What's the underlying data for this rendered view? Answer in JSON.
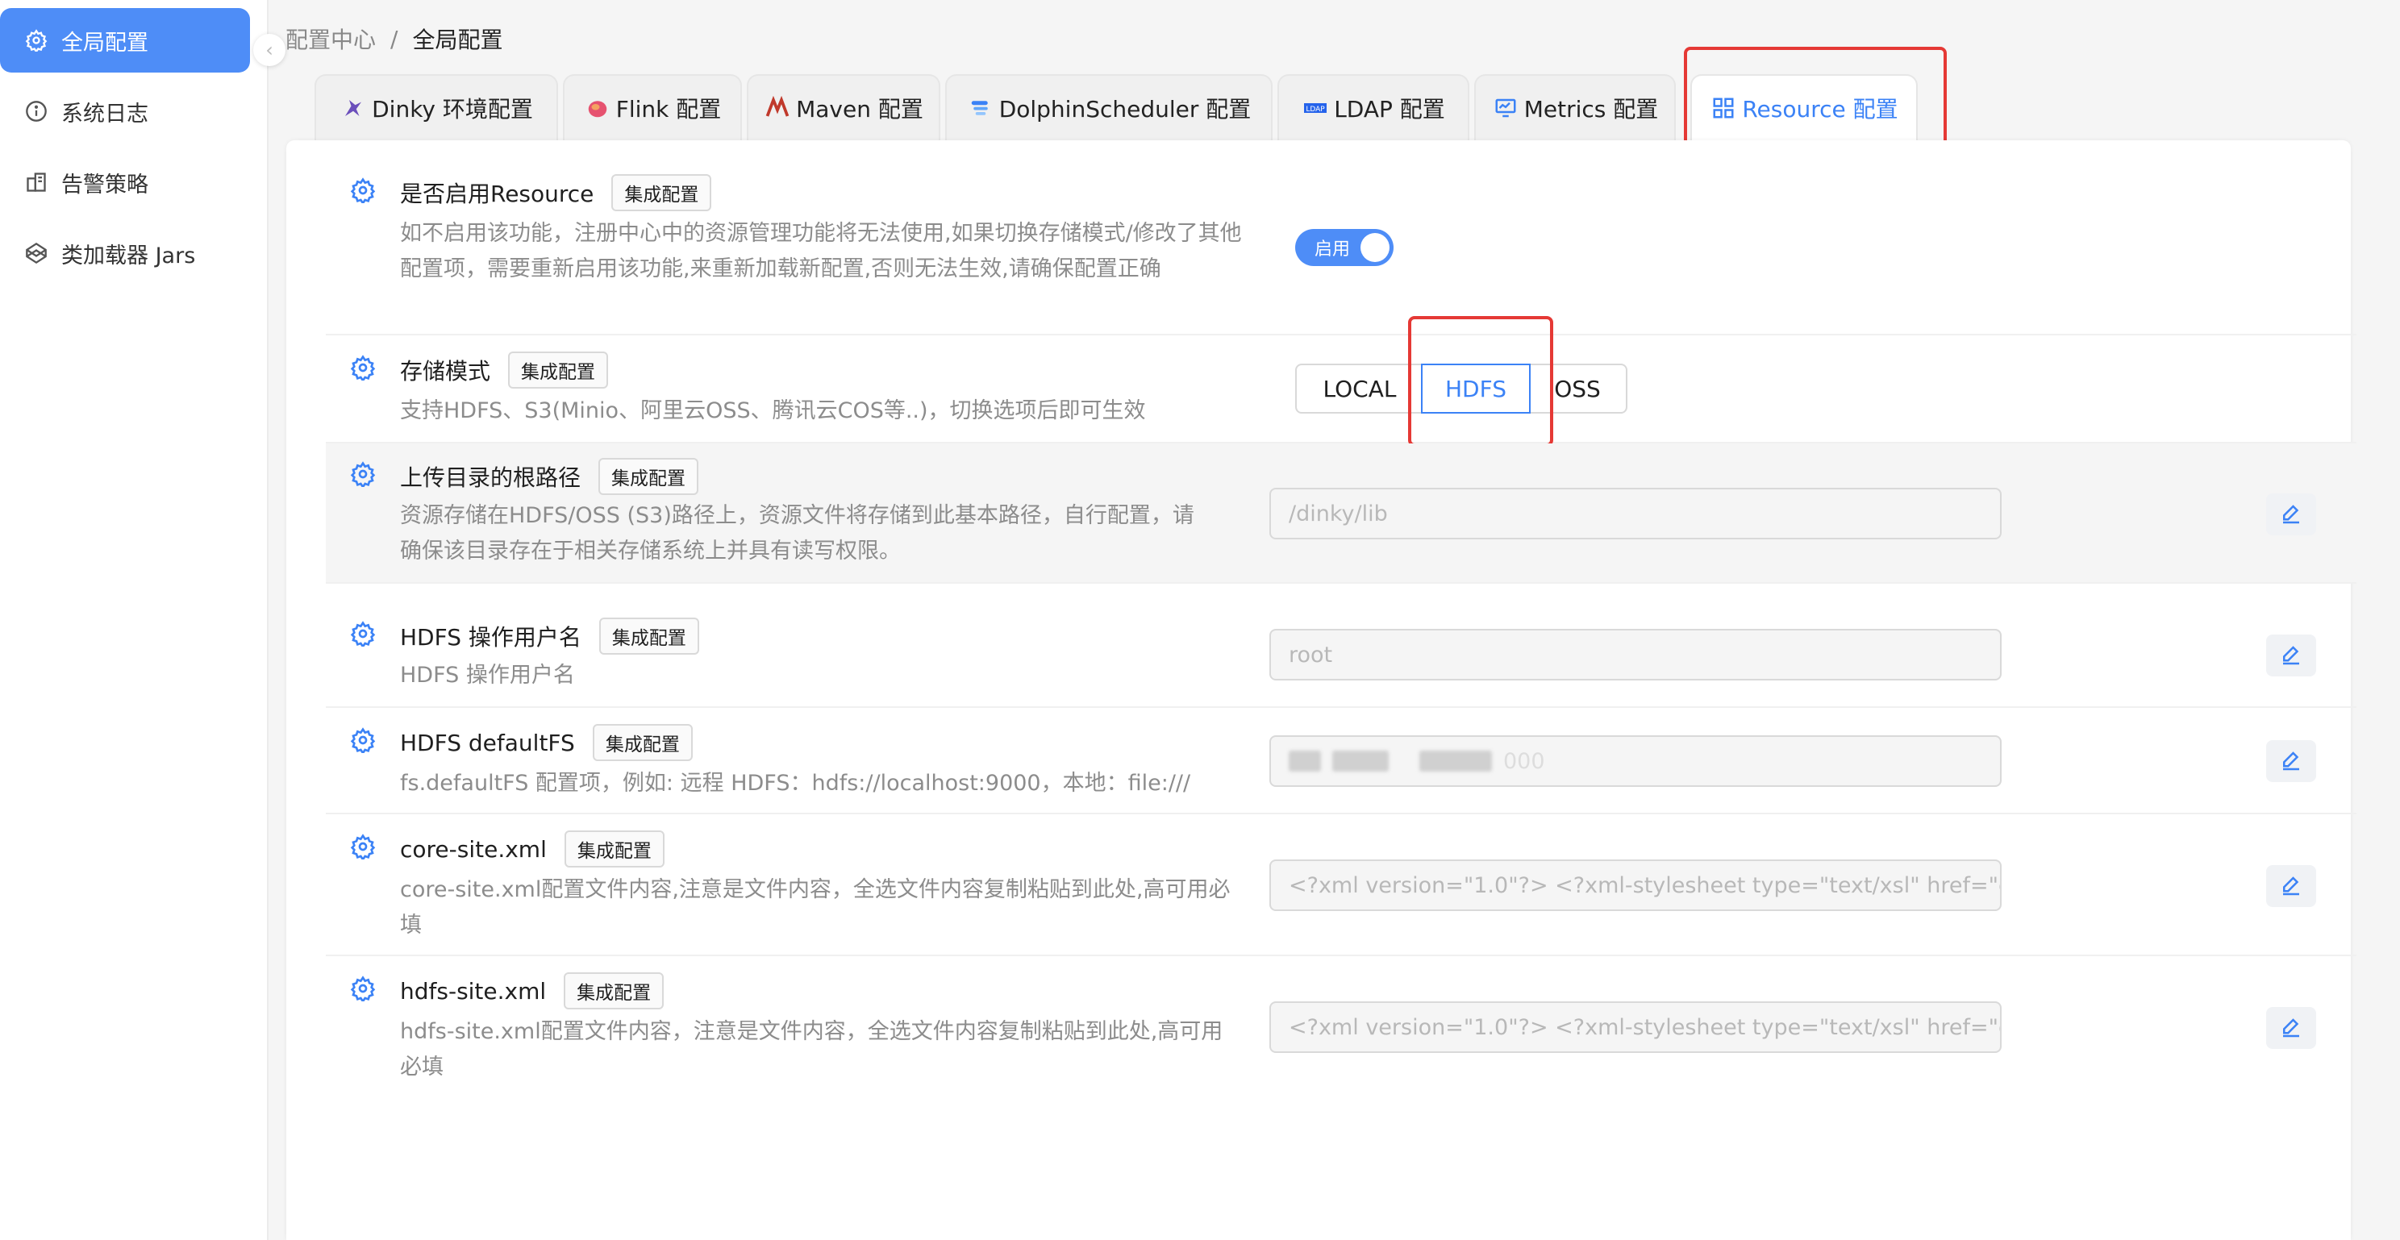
{
  "sidebar": {
    "items": [
      {
        "label": "全局配置",
        "icon": "gear-icon",
        "active": true
      },
      {
        "label": "系统日志",
        "icon": "info-icon",
        "active": false
      },
      {
        "label": "告警策略",
        "icon": "building-icon",
        "active": false
      },
      {
        "label": "类加载器 Jars",
        "icon": "codepen-icon",
        "active": false
      }
    ]
  },
  "breadcrumb": {
    "parent": "配置中心",
    "separator": "/",
    "current": "全局配置"
  },
  "tabs": [
    {
      "label": "Dinky 环境配置",
      "icon": "dinky-logo-icon"
    },
    {
      "label": "Flink 配置",
      "icon": "flink-logo-icon"
    },
    {
      "label": "Maven 配置",
      "icon": "maven-logo-icon"
    },
    {
      "label": "DolphinScheduler 配置",
      "icon": "dolphinscheduler-logo-icon"
    },
    {
      "label": "LDAP 配置",
      "icon": "ldap-logo-icon"
    },
    {
      "label": "Metrics 配置",
      "icon": "monitor-icon"
    },
    {
      "label": "Resource 配置",
      "icon": "apps-icon",
      "active": true
    }
  ],
  "config": {
    "tag": "集成配置",
    "enable": {
      "title": "是否启用Resource",
      "desc": "如不启用该功能，注册中心中的资源管理功能将无法使用,如果切换存储模式/修改了其他配置项，需要重新启用该功能,来重新加载新配置,否则无法生效,请确保配置正确",
      "switch_label": "启用",
      "enabled": true
    },
    "storage": {
      "title": "存储模式",
      "desc": "支持HDFS、S3(Minio、阿里云OSS、腾讯云COS等..)，切换选项后即可生效",
      "options": [
        "LOCAL",
        "HDFS",
        "OSS"
      ],
      "selected": "HDFS"
    },
    "upload_path": {
      "title": "上传目录的根路径",
      "desc": "资源存储在HDFS/OSS (S3)路径上，资源文件将存储到此基本路径，自行配置，请确保该目录存在于相关存储系统上并具有读写权限。",
      "value": "/dinky/lib"
    },
    "hdfs_user": {
      "title": "HDFS 操作用户名",
      "desc": "HDFS 操作用户名",
      "value": "root"
    },
    "hdfs_default_fs": {
      "title": "HDFS defaultFS",
      "desc": "fs.defaultFS 配置项，例如: 远程 HDFS：hdfs://localhost:9000，本地：file:///",
      "value_tail": "000"
    },
    "core_site": {
      "title": "core-site.xml",
      "desc": "core-site.xml配置文件内容,注意是文件内容，全选文件内容复制粘贴到此处,高可用必填",
      "value": "<?xml version=\"1.0\"?> <?xml-stylesheet type=\"text/xsl\" href=\"configuration.xsl\"?>"
    },
    "hdfs_site": {
      "title": "hdfs-site.xml",
      "desc": "hdfs-site.xml配置文件内容，注意是文件内容，全选文件内容复制粘贴到此处,高可用必填",
      "value": "<?xml version=\"1.0\"?> <?xml-stylesheet type=\"text/xsl\" href=\"configuration.xsl\"?>"
    }
  },
  "colors": {
    "primary": "#4e8df7",
    "annotation_red": "#e53935"
  }
}
